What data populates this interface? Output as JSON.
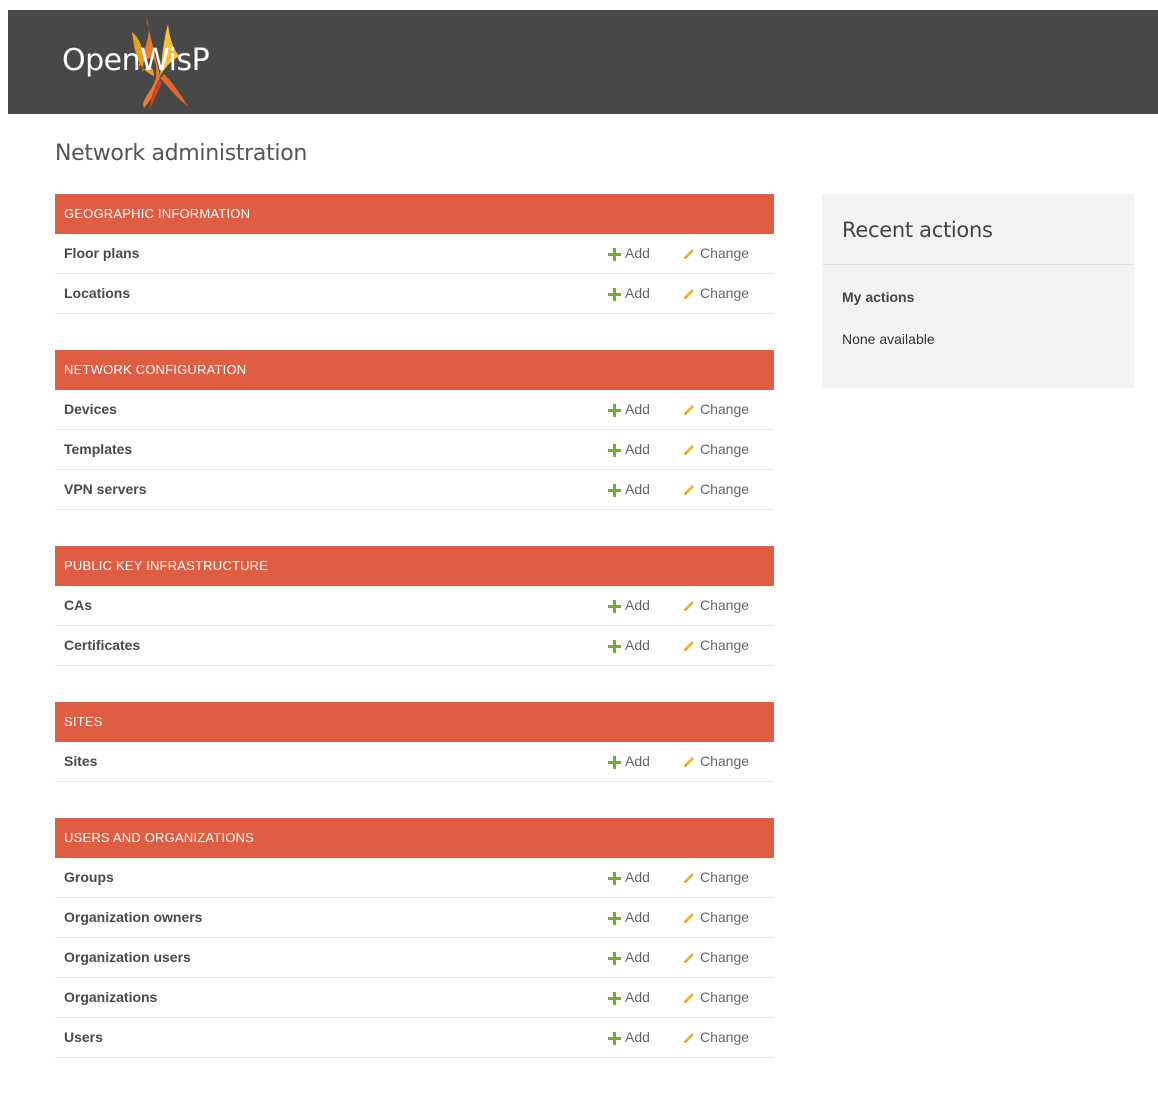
{
  "header": {
    "logo_text": "OpenWisP"
  },
  "page_title": "Network administration",
  "modules": [
    {
      "title": "GEOGRAPHIC INFORMATION",
      "rows": [
        {
          "name": "Floor plans",
          "add": "Add",
          "change": "Change"
        },
        {
          "name": "Locations",
          "add": "Add",
          "change": "Change"
        }
      ]
    },
    {
      "title": "NETWORK CONFIGURATION",
      "rows": [
        {
          "name": "Devices",
          "add": "Add",
          "change": "Change"
        },
        {
          "name": "Templates",
          "add": "Add",
          "change": "Change"
        },
        {
          "name": "VPN servers",
          "add": "Add",
          "change": "Change"
        }
      ]
    },
    {
      "title": "PUBLIC KEY INFRASTRUCTURE",
      "rows": [
        {
          "name": "CAs",
          "add": "Add",
          "change": "Change"
        },
        {
          "name": "Certificates",
          "add": "Add",
          "change": "Change"
        }
      ]
    },
    {
      "title": "SITES",
      "rows": [
        {
          "name": "Sites",
          "add": "Add",
          "change": "Change"
        }
      ]
    },
    {
      "title": "USERS AND ORGANIZATIONS",
      "rows": [
        {
          "name": "Groups",
          "add": "Add",
          "change": "Change"
        },
        {
          "name": "Organization owners",
          "add": "Add",
          "change": "Change"
        },
        {
          "name": "Organization users",
          "add": "Add",
          "change": "Change"
        },
        {
          "name": "Organizations",
          "add": "Add",
          "change": "Change"
        },
        {
          "name": "Users",
          "add": "Add",
          "change": "Change"
        }
      ]
    }
  ],
  "recent_actions": {
    "title": "Recent actions",
    "subtitle": "My actions",
    "empty_text": "None available"
  },
  "icons": {
    "add": "plus-icon",
    "change": "pencil-icon"
  },
  "colors": {
    "header_bg": "#484848",
    "module_header": "#df5d43",
    "add_icon": "#6fb12f",
    "change_icon": "#e8b91c",
    "recent_bg": "#f3f3f3"
  }
}
